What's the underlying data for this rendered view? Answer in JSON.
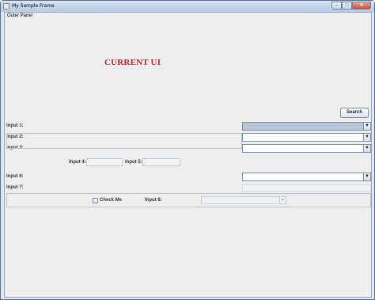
{
  "window": {
    "title": "My Sample Frame",
    "buttons": {
      "minimize": "–",
      "maximize": "□",
      "close": "✕"
    }
  },
  "outer_panel": {
    "label": "Outer Panel"
  },
  "banner": {
    "text": "CURRENT UI",
    "color": "#c0262c"
  },
  "search": {
    "label": "Search"
  },
  "inputs": {
    "input1": {
      "label": "Input 1:",
      "value": ""
    },
    "input2": {
      "label": "Input 2:",
      "value": ""
    },
    "input3": {
      "label": "Input 3:",
      "value": ""
    },
    "input4": {
      "label": "Input 4:",
      "value": ""
    },
    "input5": {
      "label": "Input 5:",
      "value": ""
    },
    "input6": {
      "label": "Input 6:",
      "value": ""
    },
    "input7": {
      "label": "Input 7:",
      "value": ""
    },
    "input8": {
      "label": "Input 8:",
      "value": ""
    }
  },
  "checkbox": {
    "label": "Check Me",
    "checked": false
  },
  "icons": {
    "combo_arrow": "chevron-down-icon",
    "app": "java-app-icon"
  }
}
